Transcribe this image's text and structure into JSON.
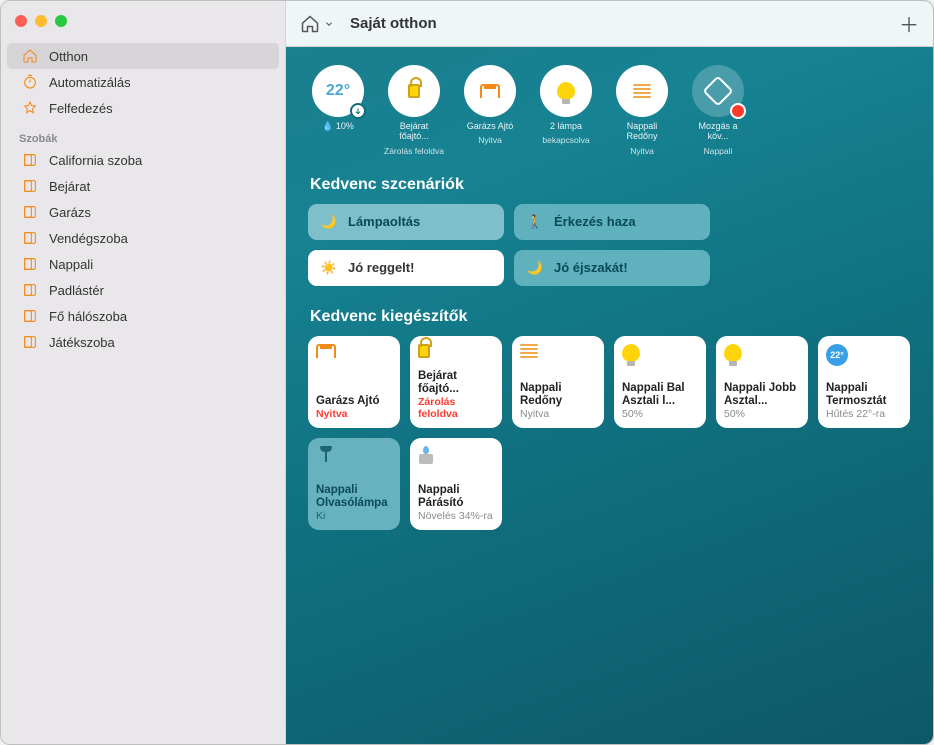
{
  "topbar": {
    "title": "Saját otthon"
  },
  "sidebar": {
    "main": [
      {
        "label": "Otthon"
      },
      {
        "label": "Automatizálás"
      },
      {
        "label": "Felfedezés"
      }
    ],
    "rooms_header": "Szobák",
    "rooms": [
      {
        "label": "California szoba"
      },
      {
        "label": "Bejárat"
      },
      {
        "label": "Garázs"
      },
      {
        "label": "Vendégszoba"
      },
      {
        "label": "Nappali"
      },
      {
        "label": "Padlástér"
      },
      {
        "label": "Fő hálószoba"
      },
      {
        "label": "Játékszoba"
      }
    ]
  },
  "status": {
    "temp": {
      "value": "22°",
      "humidity": "10%"
    },
    "items": [
      {
        "line1": "Bejárat főajtó...",
        "line2": "Zárolás feloldva"
      },
      {
        "line1": "Garázs Ajtó",
        "line2": "Nyitva"
      },
      {
        "line1": "2 lámpa",
        "line2": "bekapcsolva"
      },
      {
        "line1": "Nappali Redőny",
        "line2": "Nyitva"
      },
      {
        "line1": "Mozgás a köv...",
        "line2": "Nappali"
      }
    ]
  },
  "scenes_title": "Kedvenc szcenáriók",
  "scenes": [
    {
      "label": "Lámpaoltás"
    },
    {
      "label": "Érkezés haza"
    },
    {
      "label": "Jó reggelt!"
    },
    {
      "label": "Jó éjszakát!"
    }
  ],
  "acc_title": "Kedvenc kiegészítők",
  "acc": [
    {
      "name": "Garázs Ajtó",
      "state": "Nyitva",
      "red": true
    },
    {
      "name": "Bejárat főajtó...",
      "state": "Zárolás feloldva",
      "red": true
    },
    {
      "name": "Nappali Redőny",
      "state": "Nyitva"
    },
    {
      "name": "Nappali Bal Asztali l...",
      "state": "50%"
    },
    {
      "name": "Nappali Jobb Asztal...",
      "state": "50%"
    },
    {
      "name": "Nappali Termosztát",
      "state": "Hűtés 22°-ra",
      "therm": "22°"
    },
    {
      "name": "Nappali Olvasólámpa",
      "state": "Ki"
    },
    {
      "name": "Nappali Párásító",
      "state": "Növelés 34%-ra"
    }
  ]
}
